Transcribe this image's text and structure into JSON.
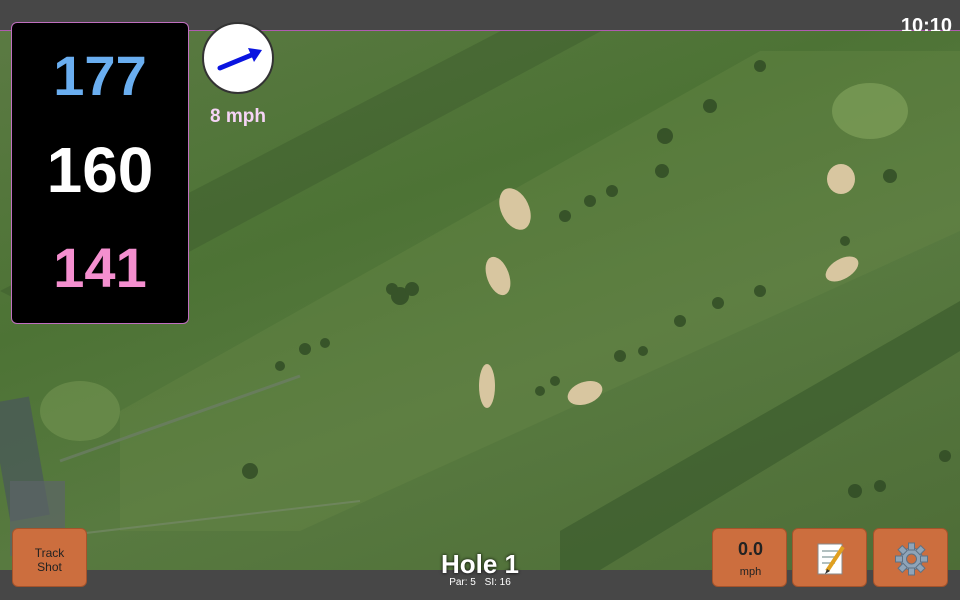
{
  "status_bar": {
    "time": "10:10"
  },
  "distances": {
    "back": "177",
    "middle": "160",
    "front": "141"
  },
  "wind": {
    "direction_icon": "arrow-icon",
    "speed_text": "8 mph"
  },
  "buttons": {
    "track_shot_line1": "Track",
    "track_shot_line2": "Shot",
    "speed_value": "0.0",
    "speed_unit": "mph",
    "notes_icon": "notepad-icon",
    "settings_icon": "gear-icon"
  },
  "hole": {
    "title": "Hole 1",
    "par": "Par: 5",
    "si": "SI: 16"
  },
  "colors": {
    "back_distance": "#6aaef0",
    "middle_distance": "#ffffff",
    "front_distance": "#f48fcf",
    "button": "#cc6e3e",
    "wind_arrow": "#0a14e0"
  }
}
